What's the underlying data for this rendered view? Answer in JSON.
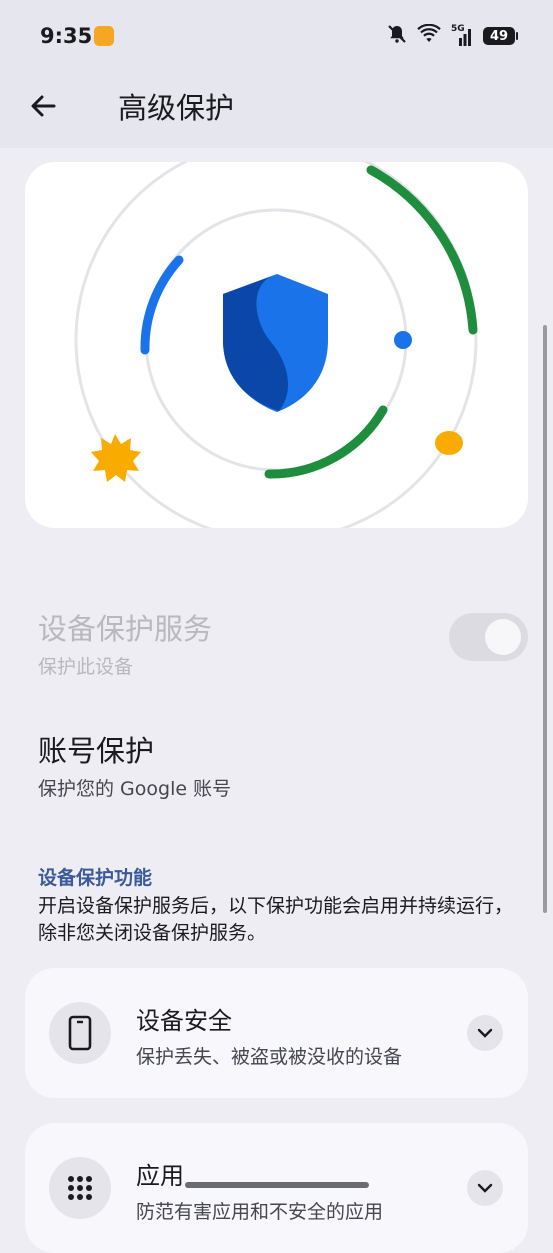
{
  "status_bar": {
    "time": "9:35",
    "network": "5G",
    "battery": "49"
  },
  "header": {
    "title": "高级保护"
  },
  "device_protection": {
    "title": "设备保护服务",
    "subtitle": "保护此设备",
    "enabled": false
  },
  "account_protection": {
    "title": "账号保护",
    "subtitle": "保护您的 Google 账号"
  },
  "features_section": {
    "header": "设备保护功能",
    "description": "开启设备保护服务后，以下保护功能会启用并持续运行，除非您关闭设备保护服务。"
  },
  "feature_cards": [
    {
      "title": "设备安全",
      "subtitle": "保护丢失、被盗或被没收的设备",
      "icon": "phone-icon"
    },
    {
      "title": "应用",
      "subtitle": "防范有害应用和不安全的应用",
      "icon": "apps-grid-icon"
    }
  ],
  "colors": {
    "accent_blue": "#1a73e8",
    "accent_green": "#1e8e3e",
    "accent_yellow": "#f9ab00",
    "section_header": "#3a5a9b"
  }
}
